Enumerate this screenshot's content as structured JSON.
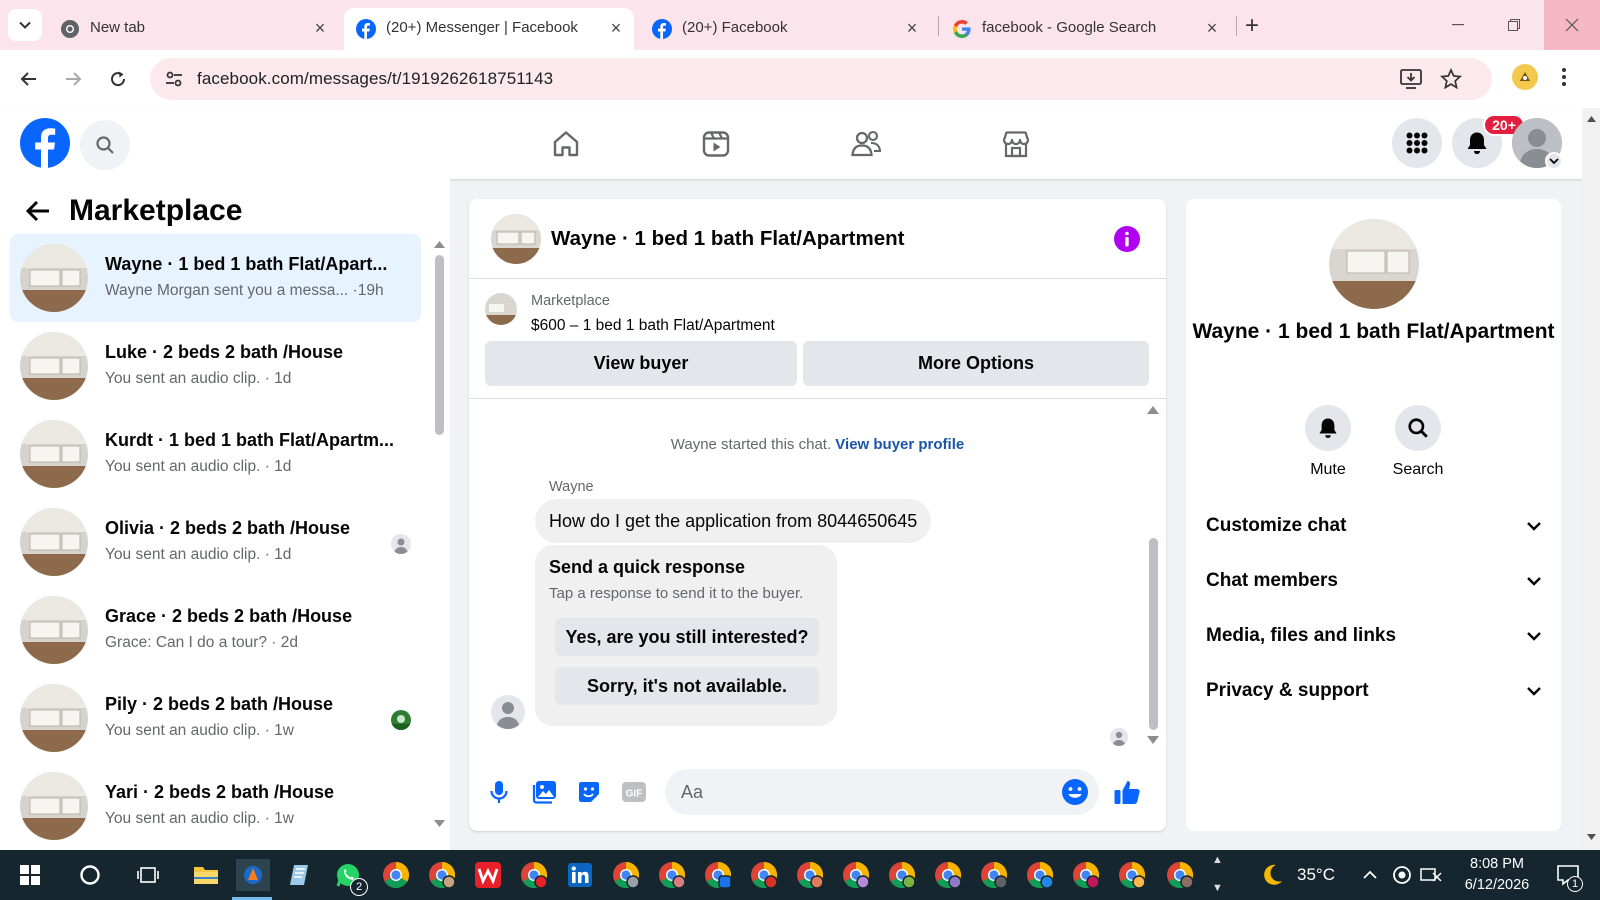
{
  "browser": {
    "tabs": [
      {
        "title": "New tab",
        "icon": "chrome-icon",
        "active": false
      },
      {
        "title": "(20+) Messenger | Facebook",
        "icon": "facebook-icon",
        "active": true
      },
      {
        "title": "(20+) Facebook",
        "icon": "facebook-icon",
        "active": false
      },
      {
        "title": "facebook - Google Search",
        "icon": "google-icon",
        "active": false
      }
    ],
    "url": "facebook.com/messages/t/1919262618751143"
  },
  "fb": {
    "notifications_badge": "20+",
    "brand_color": "#0866ff"
  },
  "sidebar": {
    "title": "Marketplace",
    "conversations": [
      {
        "name": "Wayne · 1 bed 1 bath Flat/Apart...",
        "preview": "Wayne Morgan sent you a messa...",
        "time": "·19h",
        "selected": true
      },
      {
        "name": "Luke · 2 beds 2 bath /House",
        "preview": "You sent an audio clip. · 1d",
        "time": ""
      },
      {
        "name": "Kurdt · 1 bed 1 bath Flat/Apartm...",
        "preview": "You sent an audio clip. · 1d",
        "time": ""
      },
      {
        "name": "Olivia · 2 beds 2 bath /House",
        "preview": "You sent an audio clip. · 1d",
        "time": ""
      },
      {
        "name": "Grace · 2 beds 2 bath /House",
        "preview": "Grace: Can I do a tour? · 2d",
        "time": ""
      },
      {
        "name": "Pily · 2 beds 2 bath /House",
        "preview": "You sent an audio clip. · 1w",
        "time": ""
      },
      {
        "name": "Yari · 2 beds 2 bath /House",
        "preview": "You sent an audio clip. · 1w",
        "time": ""
      }
    ]
  },
  "chat": {
    "title": "Wayne · 1 bed 1 bath Flat/Apartment",
    "marketplace_label": "Marketplace",
    "listing": "$600 – 1 bed 1 bath Flat/Apartment",
    "view_buyer": "View buyer",
    "more_options": "More Options",
    "started_text": "Wayne started this chat.",
    "started_link": "View buyer profile",
    "sender": "Wayne",
    "message": "How do I get the application from 8044650645",
    "quick_title": "Send a quick response",
    "quick_sub": "Tap a response to send it to the buyer.",
    "quick_options": [
      "Yes, are you still interested?",
      "Sorry, it's not available."
    ],
    "composer_placeholder": "Aa"
  },
  "info_panel": {
    "name": "Wayne · 1 bed 1 bath Flat/Apartment",
    "actions": [
      "Mute",
      "Search"
    ],
    "sections": [
      "Customize chat",
      "Chat members",
      "Media, files and links",
      "Privacy & support"
    ]
  },
  "taskbar": {
    "weather": "35°C",
    "time": "8:08 PM",
    "date": "6/12/2026",
    "notif_count": "1",
    "whatsapp_count": "2"
  }
}
